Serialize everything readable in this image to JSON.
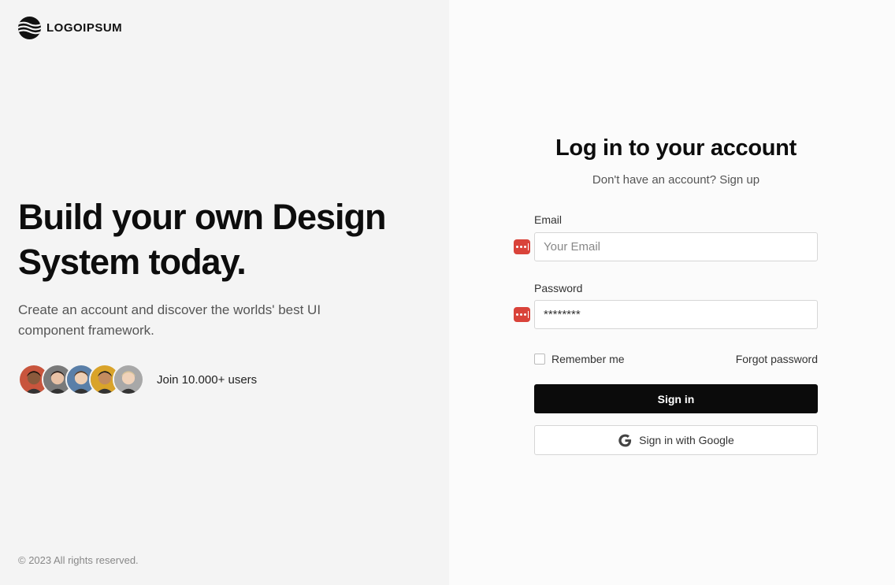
{
  "brand": {
    "logo_text": "LOGOIPSUM"
  },
  "hero": {
    "title": "Build your own Design System today.",
    "subtitle": "Create an account and discover the worlds' best UI component framework.",
    "users_label": "Join 10.000+ users",
    "avatars": [
      {
        "skin": "#8a5a3c",
        "hair": "#1b120c",
        "bg": "#c8553d"
      },
      {
        "skin": "#e9c2a6",
        "hair": "#2a1d17",
        "bg": "#7a7a7a"
      },
      {
        "skin": "#efcfb4",
        "hair": "#5a3b22",
        "bg": "#5a7fa8"
      },
      {
        "skin": "#c38b5f",
        "hair": "#1a1a1a",
        "bg": "#d9a32a"
      },
      {
        "skin": "#f0d2b9",
        "hair": "#d8c39a",
        "bg": "#a8a8a8"
      }
    ]
  },
  "footer": {
    "copyright": "© 2023 All rights reserved."
  },
  "login": {
    "title": "Log in to your account",
    "subtitle": "Don't have an account? Sign up",
    "email_label": "Email",
    "email_placeholder": "Your Email",
    "password_label": "Password",
    "password_value": "********",
    "remember_label": "Remember me",
    "forgot_label": "Forgot password",
    "signin_label": "Sign in",
    "google_label": "Sign in with Google"
  },
  "colors": {
    "left_bg": "#f4f4f4",
    "right_bg": "#fbfbfb",
    "primary_button": "#0b0b0b",
    "password_manager_icon": "#d9433a"
  },
  "icons": {
    "logo": "logo-waves-icon",
    "password_manager": "password-manager-icon",
    "google": "google-g-icon"
  }
}
